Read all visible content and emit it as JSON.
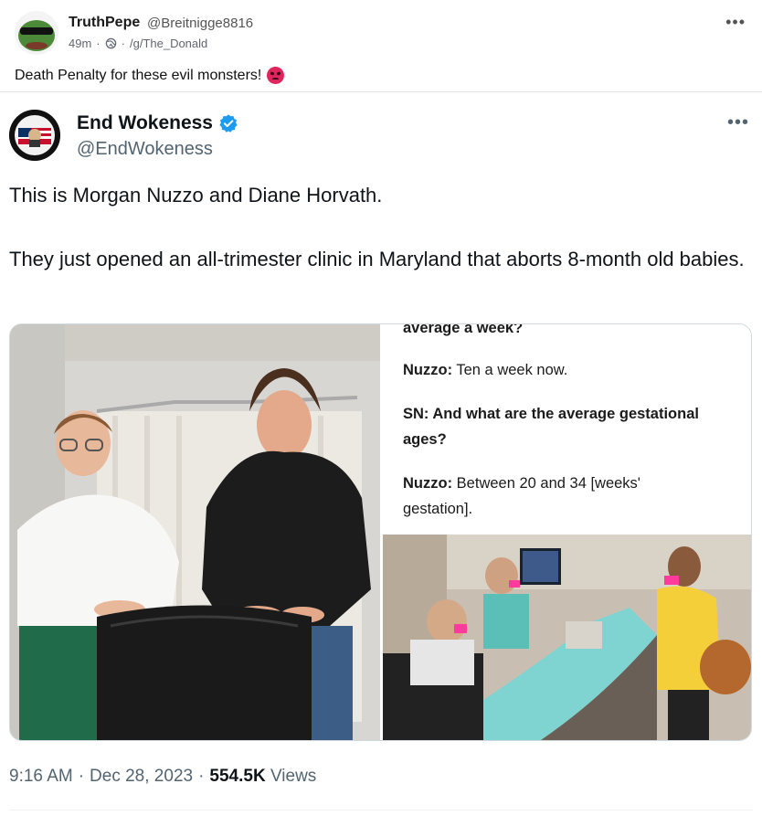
{
  "outer_post": {
    "author_name": "TruthPepe",
    "author_handle": "@Breitnigge8816",
    "time_ago": "49m",
    "separator": "·",
    "community": "/g/The_Donald",
    "text": "Death Penalty for these evil monsters!",
    "reaction_icon": "angry-face-icon",
    "more_icon": "more-horizontal-icon"
  },
  "tweet": {
    "author_name": "End Wokeness",
    "author_handle": "@EndWokeness",
    "verified": true,
    "verified_color": "#1d9bf0",
    "line1": "This is Morgan Nuzzo and Diane Horvath.",
    "line2": "They just opened an all-trimester clinic in Maryland that aborts 8-month old babies.",
    "time": "9:16 AM",
    "separator": "·",
    "date": "Dec 28, 2023",
    "separator2": "·",
    "views_count": "554.5K",
    "views_label": "Views"
  },
  "media": {
    "screenshot": {
      "partial_top": "average a week?",
      "q1_speaker": "Nuzzo:",
      "q1_answer": "Ten a week now.",
      "q2": "SN: And what are the average gestational ages?",
      "a2_speaker": "Nuzzo:",
      "a2_answer": "Between 20 and 34 [weeks' gestation]."
    }
  }
}
